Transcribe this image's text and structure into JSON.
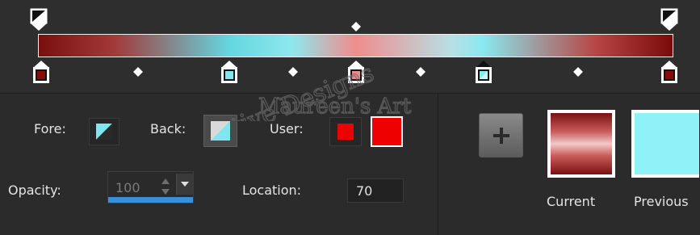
{
  "editor": {
    "fore_label": "Fore:",
    "back_label": "Back:",
    "user_label": "User:",
    "opacity_label": "Opacity:",
    "opacity_value": "100",
    "location_label": "Location:",
    "location_value": "70",
    "add_button_symbol": "+",
    "current_label": "Current",
    "previous_label": "Previous"
  },
  "colors": {
    "user_swatch_1": "#ee0000",
    "user_swatch_2": "#ee0000",
    "previous_color": "#8ef2f8",
    "accent": "#3a8fd8"
  },
  "watermark_text": "Creative Designs Maureen's Art"
}
